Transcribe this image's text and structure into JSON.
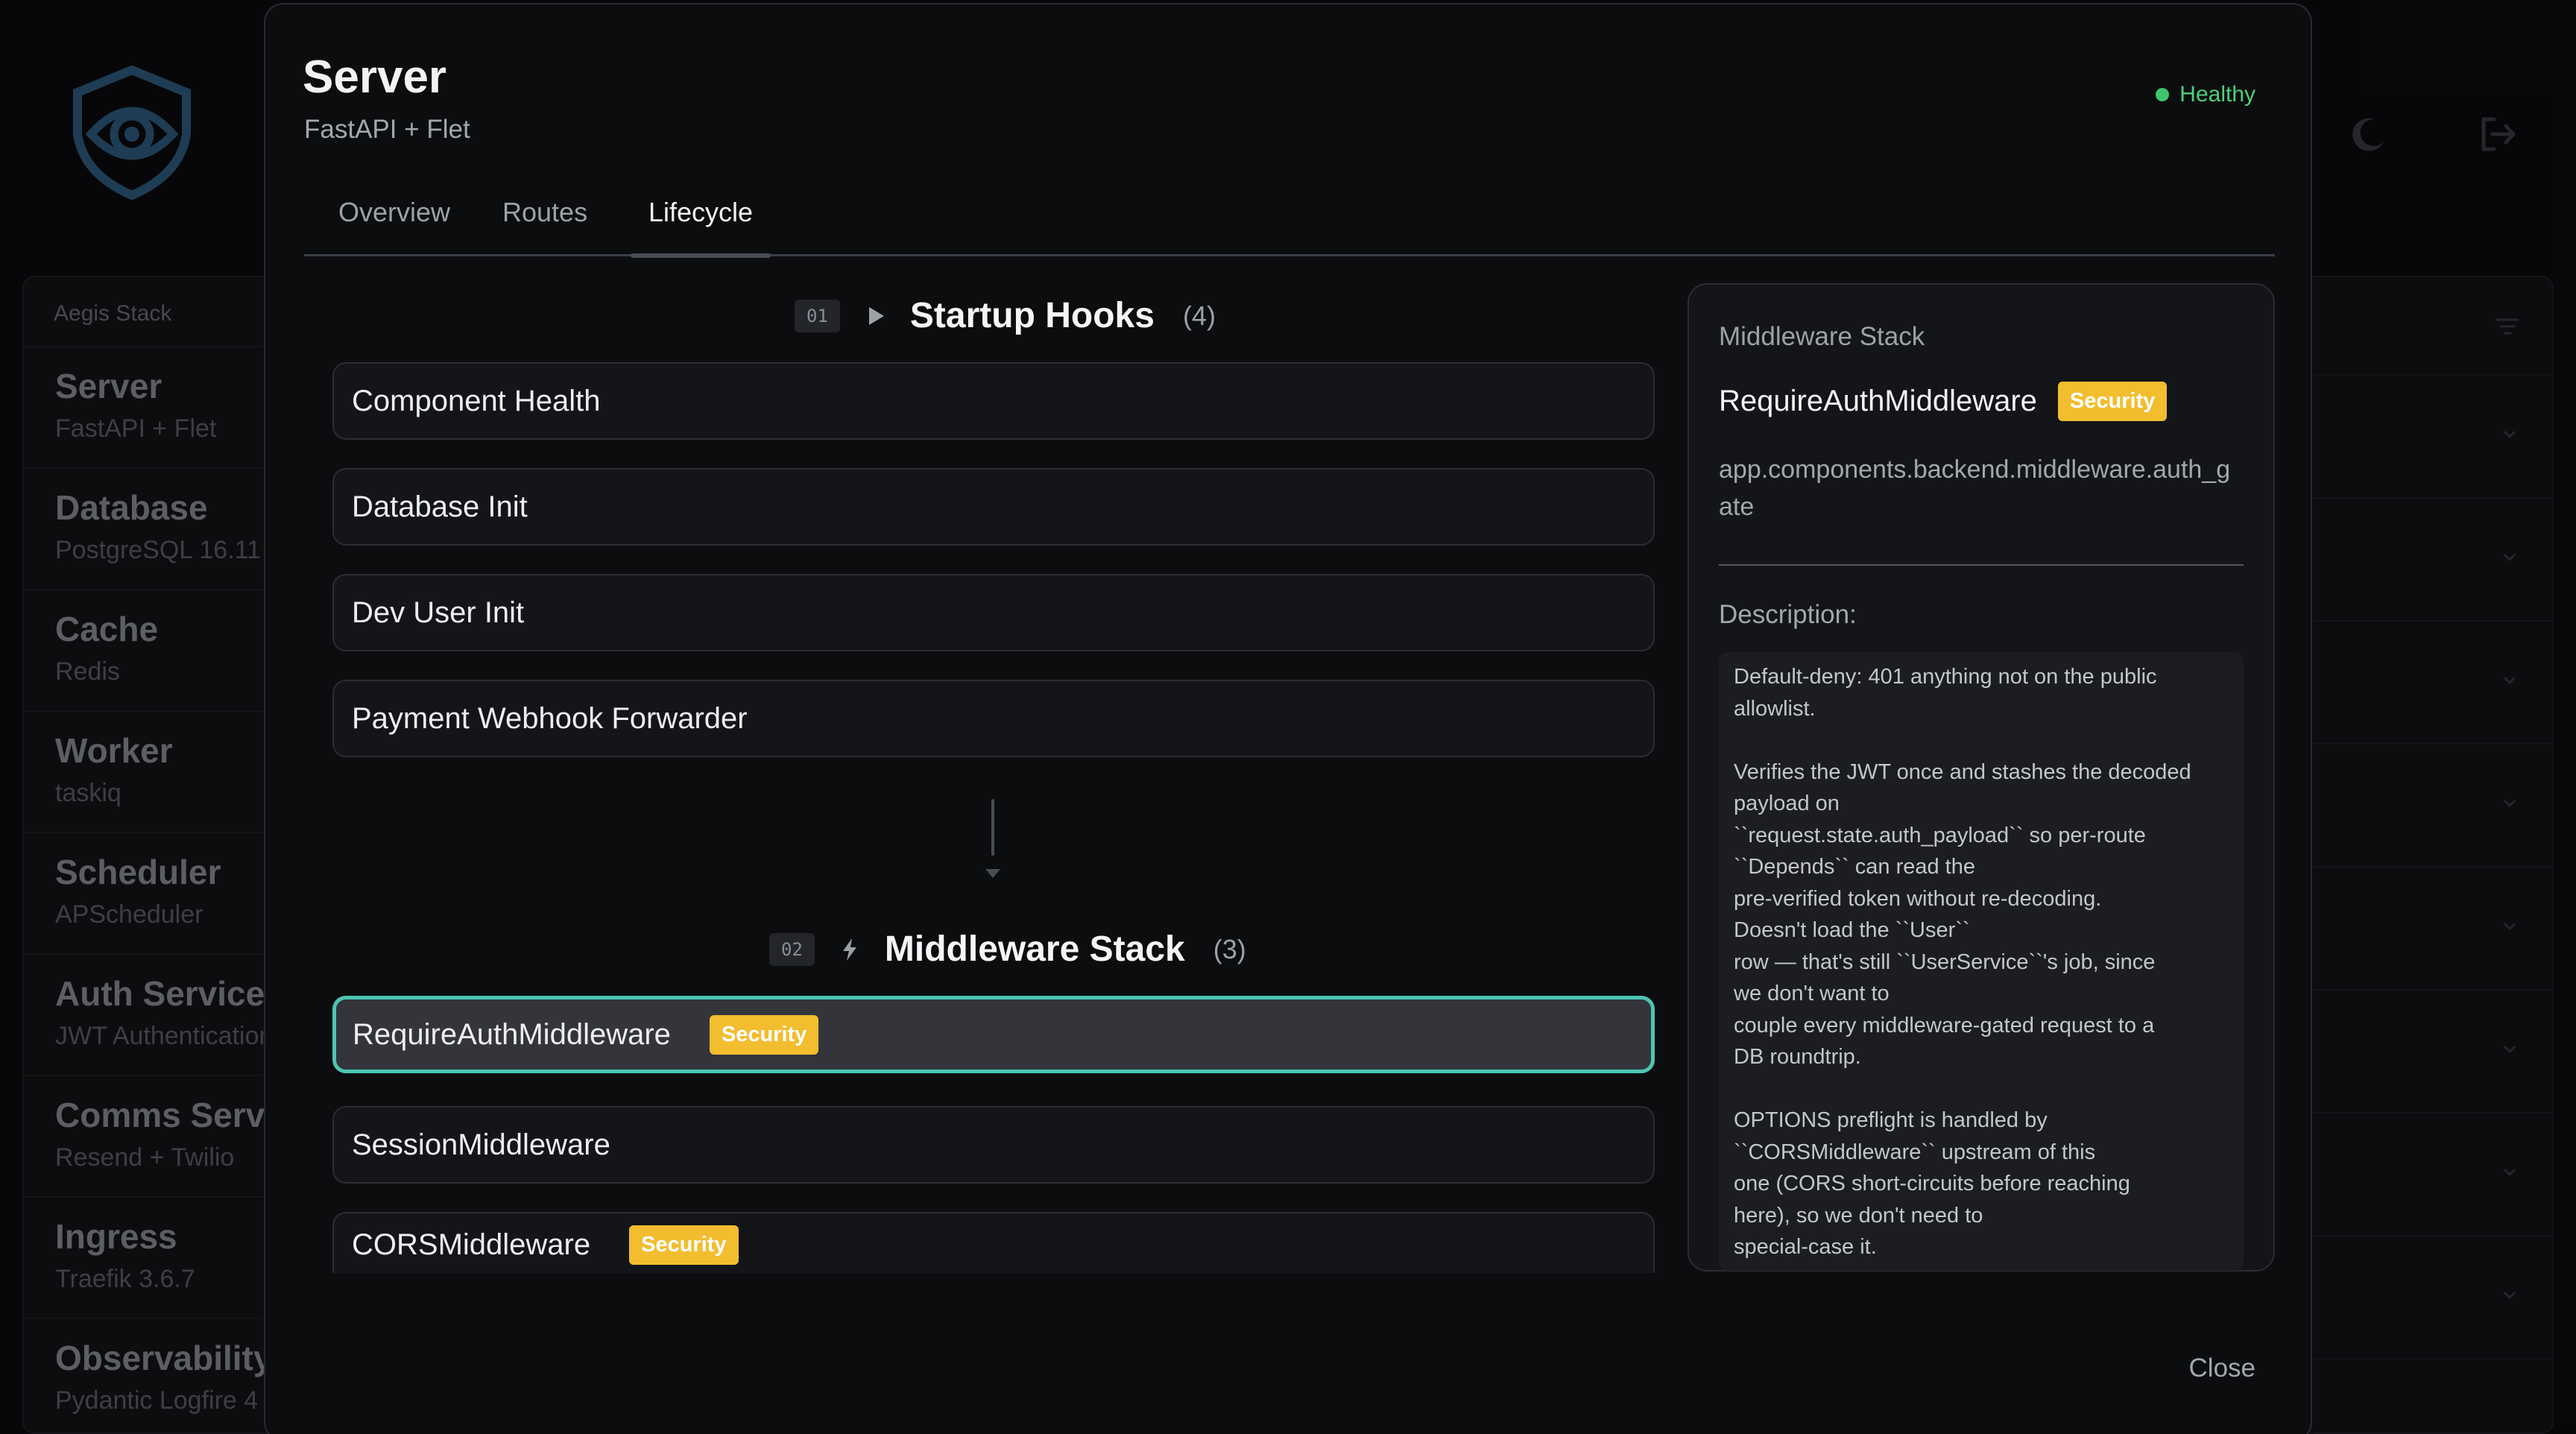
{
  "background": {
    "sidebar_title": "Aegis Stack",
    "sidebar_items": [
      {
        "name": "Server",
        "sub": "FastAPI + Flet"
      },
      {
        "name": "Database",
        "sub": "PostgreSQL 16.11"
      },
      {
        "name": "Cache",
        "sub": "Redis"
      },
      {
        "name": "Worker",
        "sub": "taskiq"
      },
      {
        "name": "Scheduler",
        "sub": "APScheduler"
      },
      {
        "name": "Auth Service",
        "sub": "JWT Authentication"
      },
      {
        "name": "Comms Service",
        "sub": "Resend + Twilio"
      },
      {
        "name": "Ingress",
        "sub": "Traefik 3.6.7"
      },
      {
        "name": "Observability",
        "sub": "Pydantic Logfire 4"
      }
    ]
  },
  "modal": {
    "title": "Server",
    "subtitle": "FastAPI + Flet",
    "health": "Healthy",
    "tabs": [
      "Overview",
      "Routes",
      "Lifecycle"
    ],
    "active_tab": "Lifecycle",
    "close_label": "Close"
  },
  "lifecycle": {
    "startup": {
      "num": "01",
      "title": "Startup Hooks",
      "count": "(4)",
      "items": [
        "Component Health",
        "Database Init",
        "Dev User Init",
        "Payment Webhook Forwarder"
      ]
    },
    "middleware": {
      "num": "02",
      "title": "Middleware Stack",
      "count": "(3)",
      "items": [
        {
          "name": "RequireAuthMiddleware",
          "badge": "Security"
        },
        {
          "name": "SessionMiddleware",
          "badge": ""
        },
        {
          "name": "CORSMiddleware",
          "badge": "Security"
        }
      ]
    }
  },
  "detail": {
    "section": "Middleware Stack",
    "name": "RequireAuthMiddleware",
    "badge": "Security",
    "path": "app.components.backend.middleware.auth_gate",
    "desc_label": "Description:",
    "description": "Default-deny: 401 anything not on the public allowlist.\n\nVerifies the JWT once and stashes the decoded payload on\n``request.state.auth_payload`` so per-route\n``Depends`` can read the\npre-verified token without re-decoding.\nDoesn't load the ``User``\nrow — that's still ``UserService``'s job, since\nwe don't want to\ncouple every middleware-gated request to a\nDB roundtrip.\n\nOPTIONS preflight is handled by\n``CORSMiddleware`` upstream of this\none (CORS short-circuits before reaching\nhere), so we don't need to\nspecial-case it."
  },
  "colors": {
    "accent": "#4cc6b4",
    "badge": "#f2bd2e",
    "healthy": "#3fc56d",
    "logo": "#2e5f82"
  }
}
